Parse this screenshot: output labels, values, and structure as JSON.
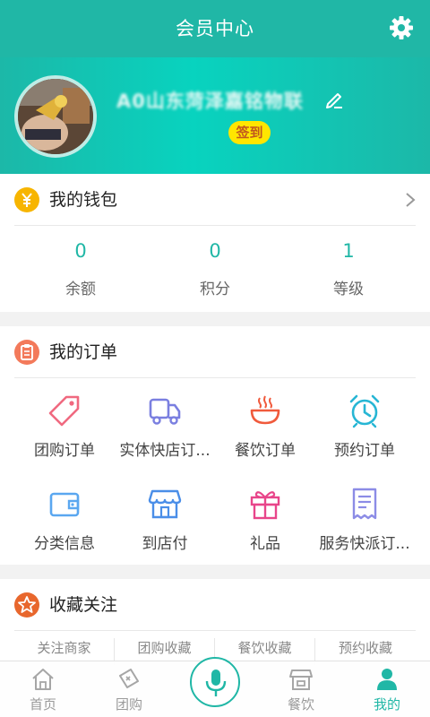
{
  "header": {
    "title": "会员中心"
  },
  "profile": {
    "nickname": "A0山东菏泽嘉铭物联",
    "signin_label": "签到"
  },
  "wallet": {
    "title": "我的钱包",
    "stats": [
      {
        "value": "0",
        "label": "余额"
      },
      {
        "value": "0",
        "label": "积分"
      },
      {
        "value": "1",
        "label": "等级"
      }
    ]
  },
  "orders": {
    "title": "我的订单",
    "items": [
      {
        "label": "团购订单",
        "icon": "tag-icon"
      },
      {
        "label": "实体快店订...",
        "icon": "truck-icon"
      },
      {
        "label": "餐饮订单",
        "icon": "bowl-icon"
      },
      {
        "label": "预约订单",
        "icon": "alarm-clock-icon"
      },
      {
        "label": "分类信息",
        "icon": "wallet-icon"
      },
      {
        "label": "到店付",
        "icon": "storefront-icon"
      },
      {
        "label": "礼品",
        "icon": "gift-icon"
      },
      {
        "label": "服务快派订...",
        "icon": "clipboard-icon"
      }
    ]
  },
  "favorites": {
    "title": "收藏关注",
    "tabs": [
      "关注商家",
      "团购收藏",
      "餐饮收藏",
      "预约收藏"
    ]
  },
  "bottom_nav": {
    "items": [
      {
        "label": "首页",
        "icon": "home-icon"
      },
      {
        "label": "团购",
        "icon": "coupon-icon"
      },
      {
        "label": "餐饮",
        "icon": "store-icon"
      },
      {
        "label": "我的",
        "icon": "user-icon"
      }
    ],
    "center_icon": "microphone-icon"
  },
  "colors": {
    "accent": "#20b7a6",
    "signin_bg": "#ffe600"
  }
}
